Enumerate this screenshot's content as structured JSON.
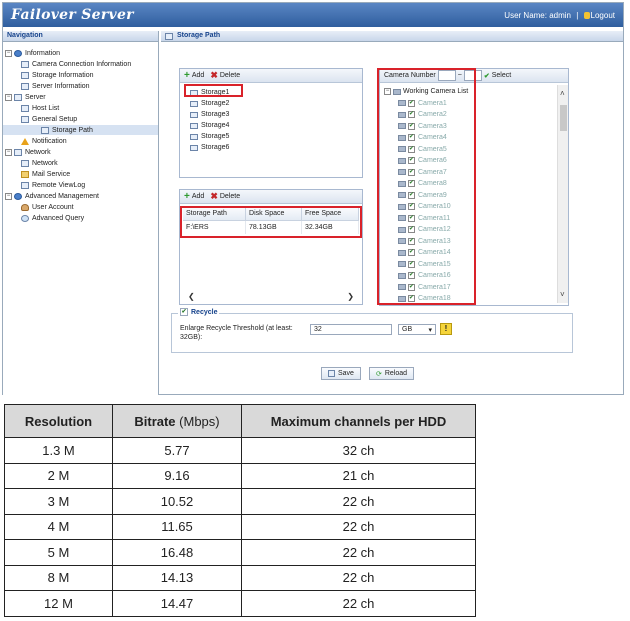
{
  "header": {
    "title": "Failover Server",
    "user_label": "User Name: admin",
    "separator": "|",
    "logout": "Logout"
  },
  "nav": {
    "title": "Navigation",
    "items": [
      {
        "label": "Information",
        "level": 0
      },
      {
        "label": "Camera Connection Information",
        "level": 1
      },
      {
        "label": "Storage Information",
        "level": 1
      },
      {
        "label": "Server Information",
        "level": 1
      },
      {
        "label": "Server",
        "level": 0
      },
      {
        "label": "Host List",
        "level": 1
      },
      {
        "label": "General Setup",
        "level": 1
      },
      {
        "label": "Storage Path",
        "level": 1,
        "selected": true
      },
      {
        "label": "Notification",
        "level": 1
      },
      {
        "label": "Network",
        "level": 0
      },
      {
        "label": "Network",
        "level": 1
      },
      {
        "label": "Mail Service",
        "level": 1
      },
      {
        "label": "Remote ViewLog",
        "level": 1
      },
      {
        "label": "Advanced Management",
        "level": 0
      },
      {
        "label": "User Account",
        "level": 1
      },
      {
        "label": "Advanced Query",
        "level": 1
      }
    ]
  },
  "main": {
    "title": "Storage Path",
    "add": "Add",
    "delete": "Delete",
    "storages": [
      "Storage1",
      "Storage2",
      "Storage3",
      "Storage4",
      "Storage5",
      "Storage6"
    ],
    "path_columns": [
      "Storage Path",
      "Disk Space",
      "Free Space"
    ],
    "path_rows": [
      [
        "F:\\ERS",
        "78.13GB",
        "32.34GB"
      ]
    ],
    "camera": {
      "number_label": "Camera Number",
      "dash": "~",
      "select": "Select",
      "list_title": "Working Camera List",
      "cameras": [
        "Camera1",
        "Camera2",
        "Camera3",
        "Camera4",
        "Camera5",
        "Camera6",
        "Camera7",
        "Camera8",
        "Camera9",
        "Camera10",
        "Camera11",
        "Camera12",
        "Camera13",
        "Camera14",
        "Camera15",
        "Camera16",
        "Camera17",
        "Camera18"
      ]
    },
    "recycle": {
      "title": "Recycle",
      "threshold_label": "Enlarge Recycle Threshold (at least: 32GB):",
      "threshold_value": "32",
      "unit": "GB",
      "help": "!"
    },
    "save": "Save",
    "reload": "Reload"
  },
  "spec_table": {
    "headers": [
      "Resolution",
      "Bitrate",
      "(Mbps)",
      "Maximum channels per HDD"
    ],
    "rows": [
      [
        "1.3 M",
        "5.77",
        "32 ch"
      ],
      [
        "2 M",
        "9.16",
        "21 ch"
      ],
      [
        "3 M",
        "10.52",
        "22 ch"
      ],
      [
        "4 M",
        "11.65",
        "22 ch"
      ],
      [
        "5 M",
        "16.48",
        "22 ch"
      ],
      [
        "8 M",
        "14.13",
        "22 ch"
      ],
      [
        "12 M",
        "14.47",
        "22 ch"
      ]
    ]
  },
  "colors": {
    "highlight": "#d9222a",
    "titlebar": "#3a6aa8"
  }
}
